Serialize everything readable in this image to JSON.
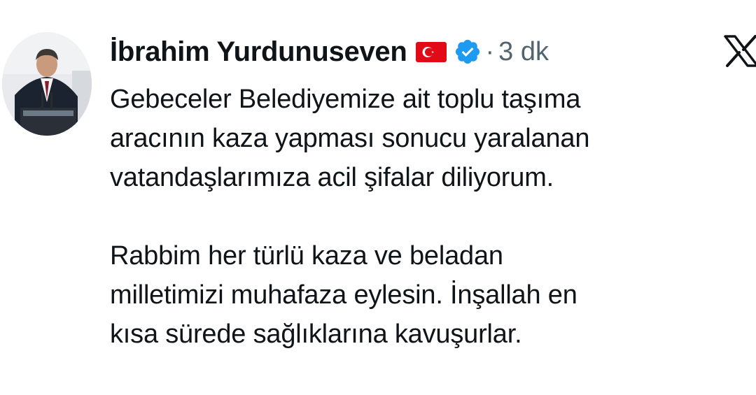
{
  "author": {
    "name": "İbrahim Yurdunuseven",
    "flag_icon": "turkey-flag-icon",
    "verified_icon": "verified-badge-icon",
    "verified_color": "#1d9bf0"
  },
  "meta": {
    "separator": "·",
    "timestamp": "3 dk"
  },
  "platform": {
    "logo_icon": "x-logo-icon"
  },
  "tweet": {
    "text": "Gebeceler Belediyemize ait toplu taşıma\naracının kaza yapması sonucu yaralanan\nvatandaşlarımıza acil şifalar diliyorum.\n\nRabbim her türlü kaza ve beladan\nmilletimizi muhafaza eylesin. İnşallah en\nkısa sürede sağlıklarına kavuşurlar."
  },
  "colors": {
    "text_primary": "#0f1419",
    "text_secondary": "#536471",
    "flag_red": "#e30a17"
  }
}
